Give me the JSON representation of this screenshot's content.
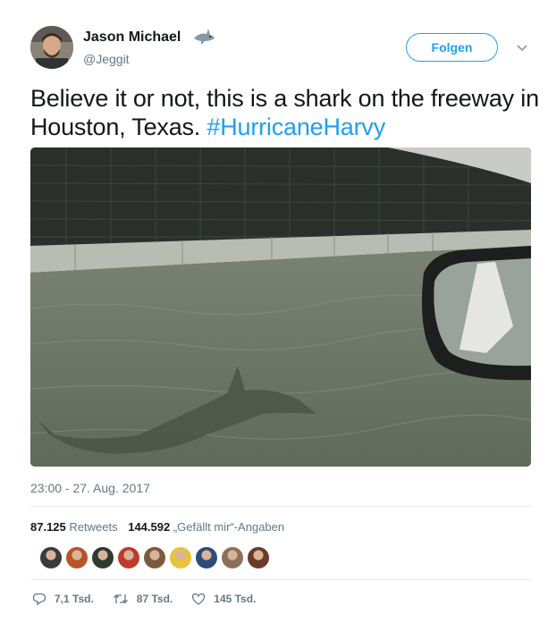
{
  "author": {
    "name": "Jason Michael",
    "handle": "@Jeggit",
    "name_emoji": "shark-icon"
  },
  "follow_button_label": "Folgen",
  "tweet": {
    "text_before": "Believe it or not, this is a shark on the freeway in Houston, Texas. ",
    "hashtag": "#HurricaneHarvy"
  },
  "timestamp": "23:00 - 27. Aug. 2017",
  "stats": {
    "retweets_count": "87.125",
    "retweets_label": "Retweets",
    "likes_count": "144.592",
    "likes_label": "„Gefällt mir“-Angaben"
  },
  "likers": [
    {
      "color": "#3a3a40",
      "name": "liker-avatar-1"
    },
    {
      "color": "#b8542a",
      "name": "liker-avatar-2"
    },
    {
      "color": "#2e3b2f",
      "name": "liker-avatar-3"
    },
    {
      "color": "#c0392b",
      "name": "liker-avatar-4"
    },
    {
      "color": "#7a5b3e",
      "name": "liker-avatar-5"
    },
    {
      "color": "#e7c33a",
      "name": "liker-avatar-6"
    },
    {
      "color": "#2c4d7a",
      "name": "liker-avatar-7"
    },
    {
      "color": "#8d6f5a",
      "name": "liker-avatar-8"
    },
    {
      "color": "#6b3b2a",
      "name": "liker-avatar-9"
    }
  ],
  "actions": {
    "replies": "7,1 Tsd.",
    "retweets": "87 Tsd.",
    "likes": "145 Tsd."
  },
  "colors": {
    "accent": "#1da1f2",
    "secondary_text": "#657786",
    "primary_text": "#14171a"
  }
}
